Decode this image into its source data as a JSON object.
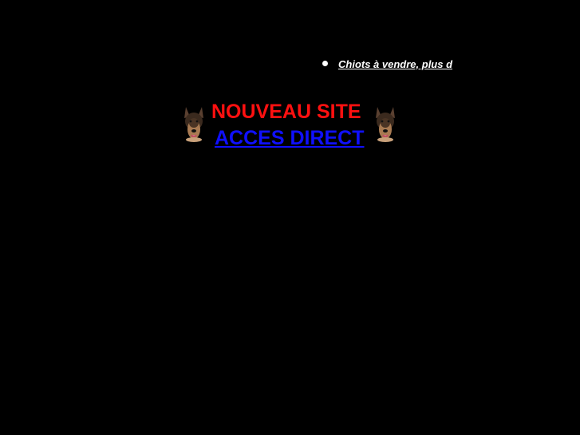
{
  "news_ticker": {
    "link_text": "Chiots à vendre, plus d"
  },
  "banner": {
    "headline": "NOUVEAU SITE",
    "access_link": "ACCES DIRECT",
    "left_image": "german-shepherd-head-icon",
    "right_image": "german-shepherd-head-icon"
  },
  "colors": {
    "background": "#000000",
    "headline": "#ff1010",
    "access_link": "#1010ff",
    "ticker_text": "#ffffff"
  }
}
